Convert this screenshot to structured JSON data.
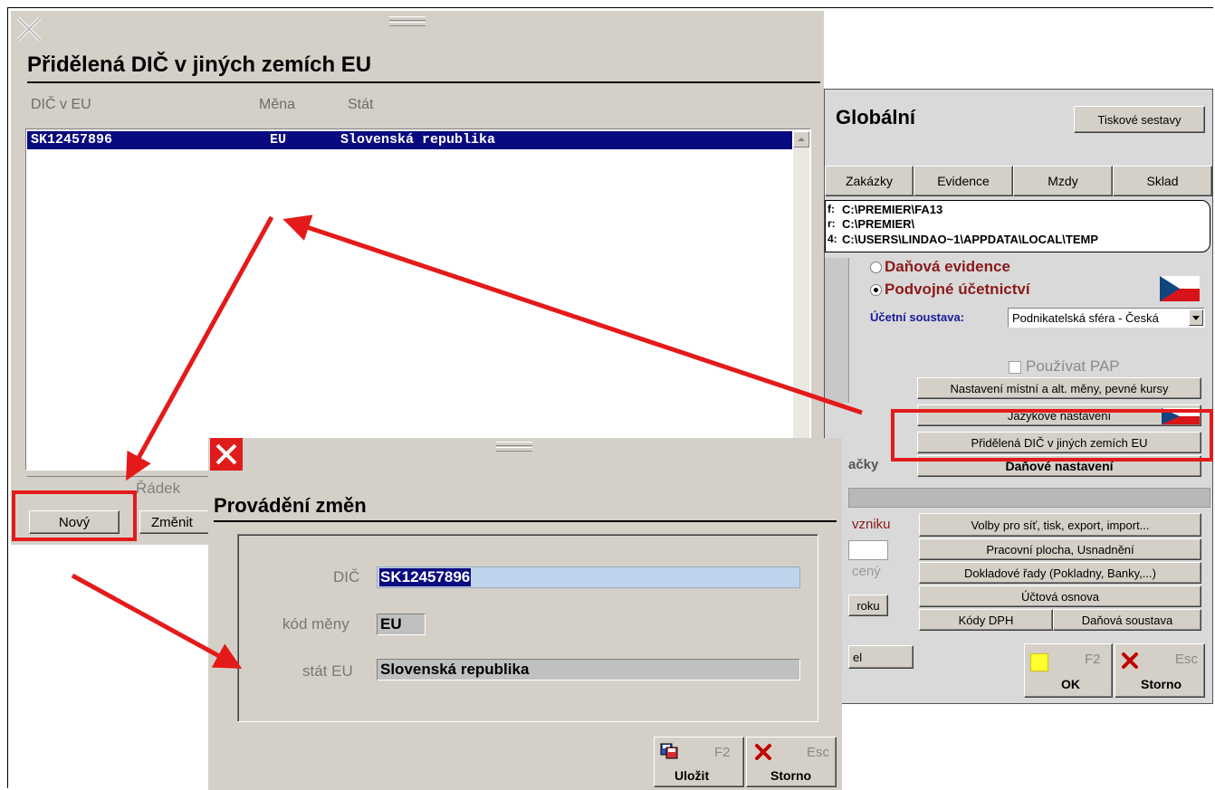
{
  "dic_list_window": {
    "title": "Přidělená DIČ v jiných zemích EU",
    "columns": [
      "DIČ v EU",
      "Měna",
      "Stát"
    ],
    "rows": [
      {
        "dic": "SK12457896",
        "mena": "EU",
        "stat": "Slovenská republika",
        "selected": true
      }
    ],
    "row_label": "Řádek",
    "new_button": "Nový",
    "change_button": "Změnit"
  },
  "global_window": {
    "title": "Globální",
    "print_button": "Tiskové sestavy",
    "tabs": [
      "Zakázky",
      "Evidence",
      "Mzdy",
      "Sklad"
    ],
    "paths": [
      {
        "prefix": "f:",
        "value": "C:\\PREMIER\\FA13"
      },
      {
        "prefix": "r:",
        "value": "C:\\PREMIER\\"
      },
      {
        "prefix": "4:",
        "value": "C:\\USERS\\LINDAO~1\\APPDATA\\LOCAL\\TEMP"
      }
    ],
    "radio_tax_evidence": "Daňová evidence",
    "radio_double_entry": "Podvojné účetnictví",
    "accounting_system_label": "Účetní soustava:",
    "accounting_system_value": "Podnikatelská sféra - Česká",
    "use_pap_label": "Používat PAP",
    "btn_local_currency": "Nastavení místní a alt. měny, pevné kursy",
    "btn_language": "Jazykové nastavení",
    "btn_dic_eu": "Přidělená DIČ v jiných zemích EU",
    "btn_tax_settings": "Daňové nastavení",
    "partial_label_machine": "ačky",
    "partial_label_origin": "vzniku",
    "partial_label_closed": "cený",
    "partial_button_year": "roku",
    "partial_button_el": "el",
    "btn_network": "Volby pro síť, tisk, export, import...",
    "btn_desktop": "Pracovní plocha, Usnadnění",
    "btn_doc_series": "Dokladové řady (Pokladny, Banky,...)",
    "btn_chart_accounts": "Účtová osnova",
    "btn_vat_codes": "Kódy DPH",
    "btn_tax_system": "Daňová soustava",
    "ok_key": "F2",
    "ok_label": "OK",
    "storno_key": "Esc",
    "storno_label": "Storno"
  },
  "edit_dialog": {
    "title": "Provádění změn",
    "dic_label": "DIČ",
    "dic_value": "SK12457896",
    "currency_label": "kód měny",
    "currency_value": "EU",
    "country_label": "stát EU",
    "country_value": "Slovenská republika",
    "save_key": "F2",
    "save_label": "Uložit",
    "storno_key": "Esc",
    "storno_label": "Storno"
  },
  "colors": {
    "annotation_red": "#e41a1a",
    "selection_blue": "#0a0a80",
    "window_gray": "#d4d0c8"
  }
}
